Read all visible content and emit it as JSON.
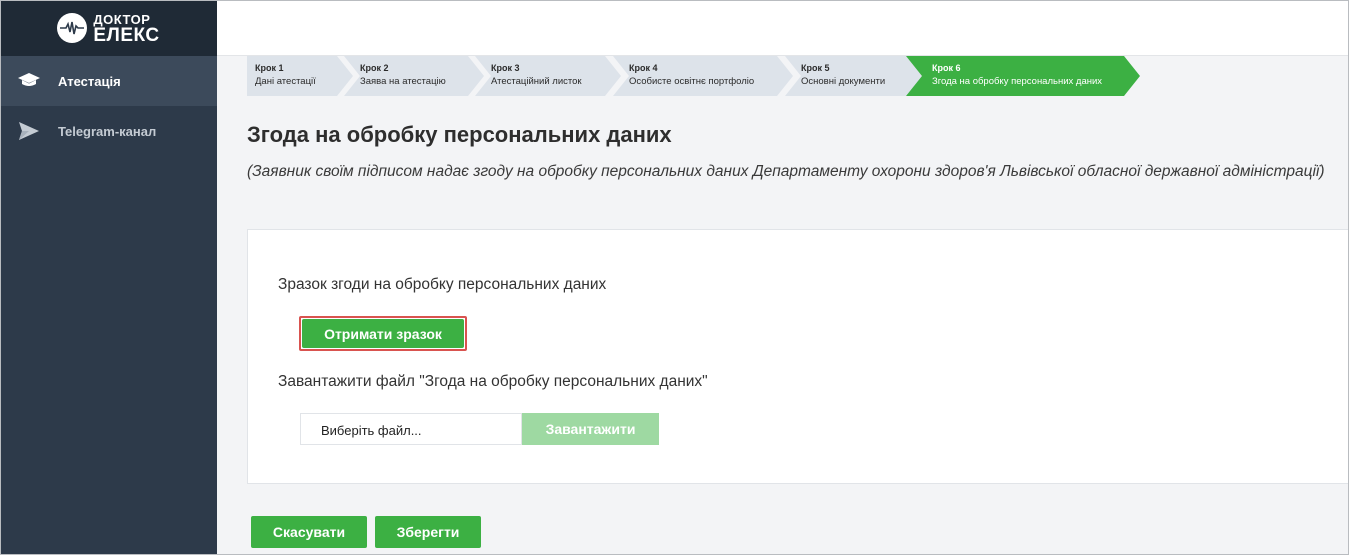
{
  "logo": {
    "line1": "ДОКТОР",
    "line2": "ЕЛЕКС"
  },
  "sidebar": {
    "items": [
      {
        "label": "Атестація",
        "icon": "graduation-cap-icon"
      },
      {
        "label": "Telegram-канал",
        "icon": "paper-plane-icon"
      }
    ]
  },
  "steps": [
    {
      "title": "Крок 1",
      "subtitle": "Дані атестації"
    },
    {
      "title": "Крок 2",
      "subtitle": "Заява на атестацію"
    },
    {
      "title": "Крок 3",
      "subtitle": "Атестаційний листок"
    },
    {
      "title": "Крок 4",
      "subtitle": "Особисте освітнє портфоліо"
    },
    {
      "title": "Крок 5",
      "subtitle": "Основні документи"
    },
    {
      "title": "Крок 6",
      "subtitle": "Згода на обробку персональних даних"
    }
  ],
  "page": {
    "title": "Згода на обробку персональних даних",
    "subtitle": "(Заявник своїм підписом надає згоду на обробку персональних даних Департаменту охорони здоров'я Львівської обласної державної адміністрації)"
  },
  "card": {
    "sample_label": "Зразок згоди на обробку персональних даних",
    "sample_button": "Отримати зразок",
    "upload_label": "Завантажити файл \"Згода на обробку персональних даних\"",
    "file_placeholder": "Виберіть файл...",
    "upload_button": "Завантажити"
  },
  "actions": {
    "cancel": "Скасувати",
    "save": "Зберегти"
  },
  "colors": {
    "accent": "#3cb043",
    "sidebar": "#2d3a4a",
    "highlight": "#d9534f"
  }
}
